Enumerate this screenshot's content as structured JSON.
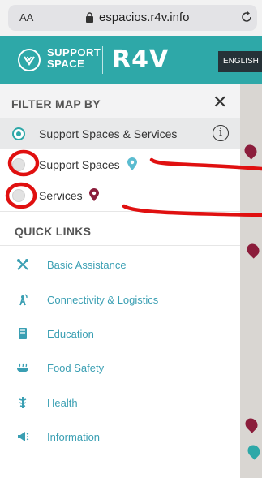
{
  "browser": {
    "aa": "AA",
    "url": "espacios.r4v.info"
  },
  "header": {
    "logo_line1": "SUPPORT",
    "logo_line2": "SPACE",
    "brand": "R4V",
    "lang_button": "ENGLISH"
  },
  "filter": {
    "title": "FILTER MAP BY",
    "options": [
      {
        "label": "Support Spaces & Services",
        "selected": true
      },
      {
        "label": "Support Spaces",
        "selected": false,
        "pin_color": "#5bbcd0"
      },
      {
        "label": "Services",
        "selected": false,
        "pin_color": "#8b1d3b"
      }
    ]
  },
  "quick_links": {
    "title": "QUICK LINKS",
    "items": [
      {
        "label": "Basic Assistance",
        "icon": "tools-icon"
      },
      {
        "label": "Connectivity & Logistics",
        "icon": "antenna-icon"
      },
      {
        "label": "Education",
        "icon": "book-icon"
      },
      {
        "label": "Food Safety",
        "icon": "food-icon"
      },
      {
        "label": "Health",
        "icon": "health-icon"
      },
      {
        "label": "Information",
        "icon": "megaphone-icon"
      }
    ]
  },
  "colors": {
    "teal": "#2ea8a8",
    "link": "#3a9fb3",
    "annotation": "#e01010"
  }
}
